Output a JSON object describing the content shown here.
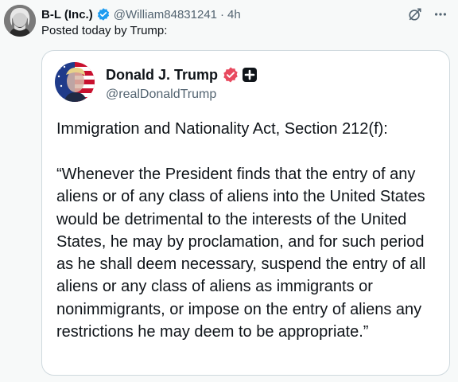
{
  "post": {
    "author_name": "B-L (Inc.)",
    "author_handle": "@William84831241",
    "separator": "·",
    "time": "4h",
    "text": "Posted today by Trump:"
  },
  "quoted": {
    "author_name": "Donald J. Trump",
    "author_handle": "@realDonaldTrump",
    "title": "Immigration and Nationality Act, Section 212(f):",
    "paragraph": "“Whenever the President finds that the entry of any aliens or of any class of aliens into the United States would be detrimental to the interests of the United States, he may by proclamation, and for such period as he shall deem necessary, suspend the entry of all aliens or any class of aliens as immigrants or nonimmigrants, or impose on the entry of aliens any restrictions he may deem to be appropriate.”"
  },
  "icons": {
    "verified": "verified-badge-icon",
    "grok": "grok-icon",
    "more": "more-icon",
    "truth_verified": "truth-verified-icon",
    "truth_plus": "truth-plus-icon"
  },
  "colors": {
    "verified_blue": "#1d9bf0",
    "truth_red": "#e84a5f",
    "muted": "#536471",
    "border": "#cfd9de"
  }
}
